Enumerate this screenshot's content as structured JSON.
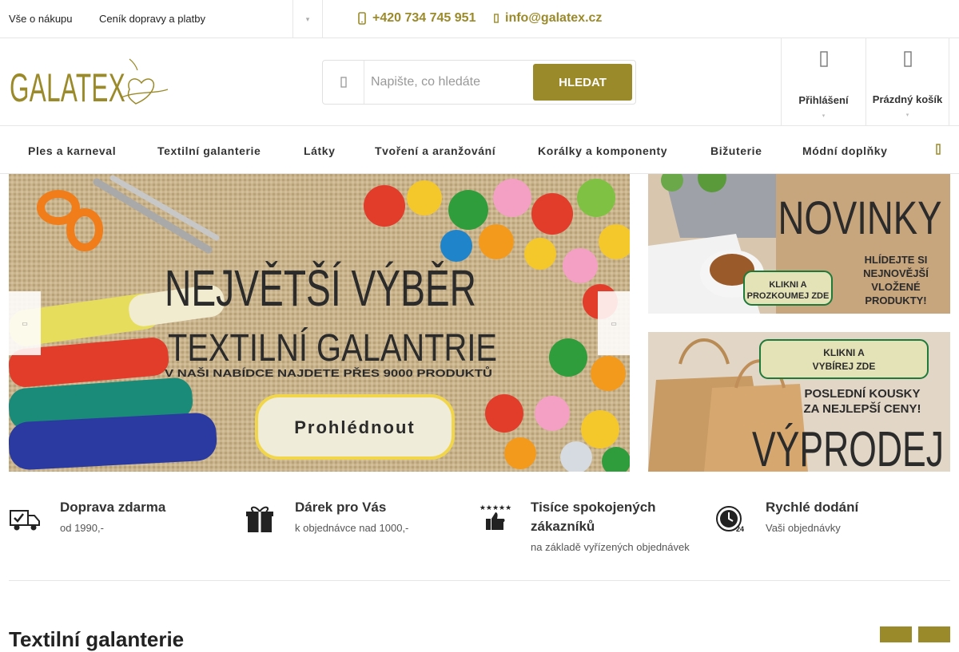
{
  "topbar": {
    "links": [
      "Vše o nákupu",
      "Ceník dopravy a platby"
    ],
    "more_icon": "chevron-down-icon",
    "phone": "+420 734 745 951",
    "email": "info@galatex.cz"
  },
  "header": {
    "logo_text": "GALATEX",
    "search": {
      "placeholder": "Napište, co hledáte",
      "button": "HLEDAT"
    },
    "login_label": "Přihlášení",
    "cart_label": "Prázdný košík"
  },
  "nav": {
    "items": [
      "Ples a karneval",
      "Textilní galanterie",
      "Látky",
      "Tvoření a aranžování",
      "Korálky a komponenty",
      "Bižuterie",
      "Módní doplňky"
    ]
  },
  "banners": {
    "main": {
      "line1": "NEJVĚTŠÍ VÝBĚR",
      "line2": "TEXTILNÍ GALANTRIE",
      "line3": "V NAŠI NABÍDCE NAJDETE PŘES 9000 PRODUKTŮ",
      "button": "Prohlédnout"
    },
    "novinky": {
      "title": "NOVINKY",
      "button": "KLIKNI A PROZKOUMEJ ZDE",
      "text": "HLÍDEJTE SI NEJNOVĚJŠÍ VLOŽENÉ PRODUKTY!"
    },
    "vyprodej": {
      "button": "KLIKNI A VYBÍREJ ZDE",
      "text": "POSLEDNÍ KOUSKY ZA NEJLEPŠÍ CENY!",
      "title": "VÝPRODEJ"
    }
  },
  "benefits": [
    {
      "icon": "truck-icon",
      "title": "Doprava zdarma",
      "subtitle": "od 1990,-"
    },
    {
      "icon": "gift-icon",
      "title": "Dárek pro Vás",
      "subtitle": "k objednávce nad 1000,-"
    },
    {
      "icon": "thumbs-up-icon",
      "title": "Tisíce spokojených zákazníků",
      "subtitle": "na základě vyřízených objednávek"
    },
    {
      "icon": "clock-24-icon",
      "title": "Rychlé dodání",
      "subtitle": "Vaši objednávky"
    }
  ],
  "section": {
    "title": "Textilní galanterie"
  },
  "colors": {
    "accent": "#9b8a2a",
    "banner_button": "#efecd9",
    "banner_text": "#2b2b2b"
  }
}
